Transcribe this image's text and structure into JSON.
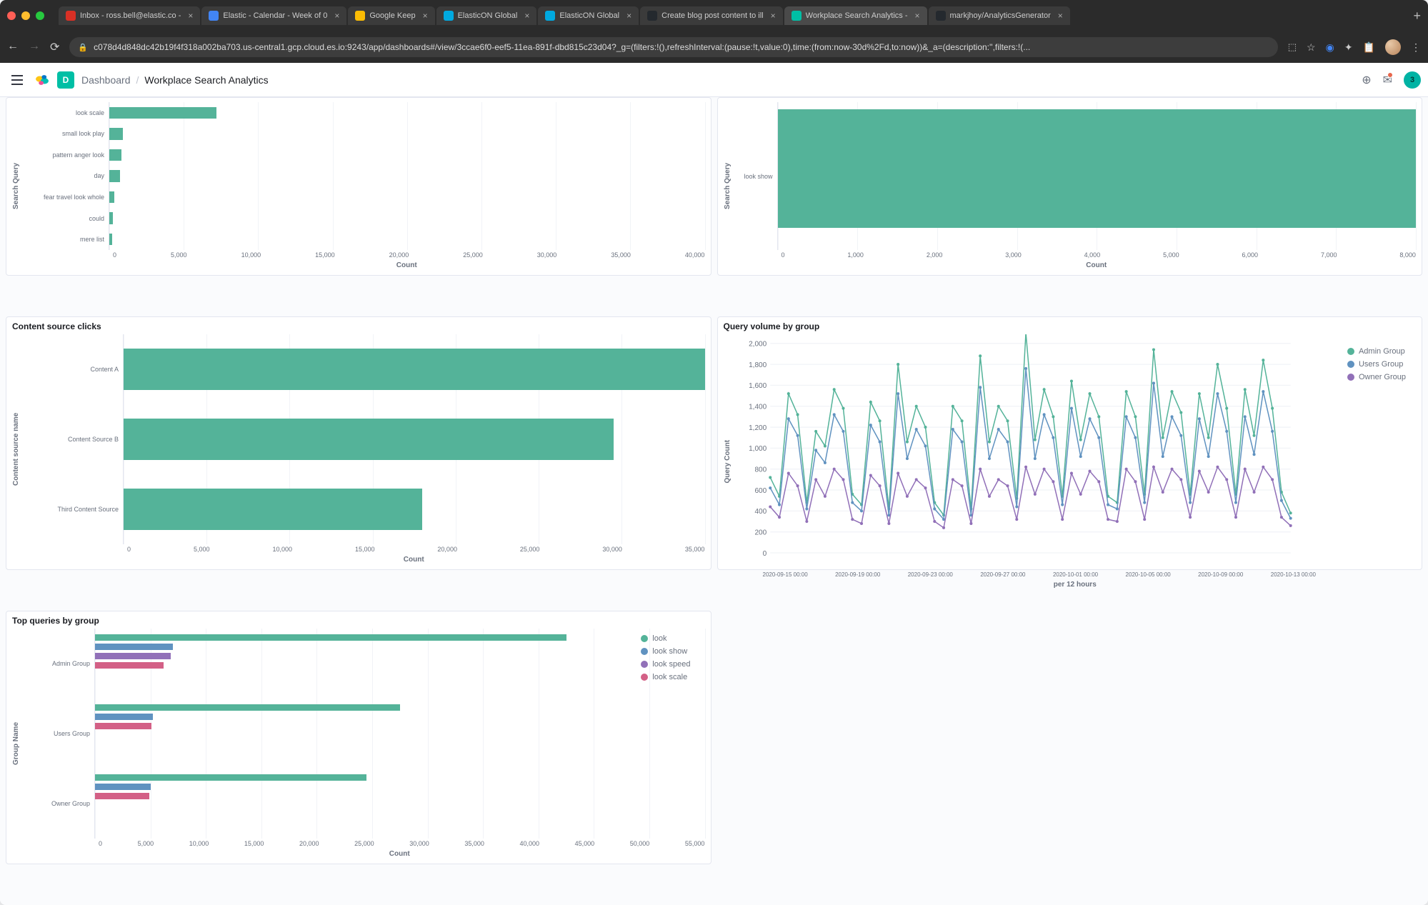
{
  "browser": {
    "tabs": [
      {
        "label": "Inbox - ross.bell@elastic.co -",
        "favicon": "#d93025"
      },
      {
        "label": "Elastic - Calendar - Week of 0",
        "favicon": "#4285f4"
      },
      {
        "label": "Google Keep",
        "favicon": "#fbbc04"
      },
      {
        "label": "ElasticON Global",
        "favicon": "#00a9e0"
      },
      {
        "label": "ElasticON Global",
        "favicon": "#00a9e0"
      },
      {
        "label": "Create blog post content to ill",
        "favicon": "#24292e"
      },
      {
        "label": "Workplace Search Analytics -",
        "favicon": "#00bfa5",
        "active": true
      },
      {
        "label": "markjhoy/AnalyticsGenerator",
        "favicon": "#24292e"
      }
    ],
    "url": "c078d4d848dc42b19f4f318a002ba703.us-central1.gcp.cloud.es.io:9243/app/dashboards#/view/3ccae6f0-eef5-11ea-891f-dbd815c23d04?_g=(filters:!(),refreshInterval:(pause:!t,value:0),time:(from:now-30d%2Fd,to:now))&_a=(description:'',filters:!(..."
  },
  "header": {
    "space_letter": "D",
    "breadcrumb1": "Dashboard",
    "breadcrumb2": "Workplace Search Analytics",
    "badge_count": "3"
  },
  "chart_data": [
    {
      "id": "panel1",
      "type": "bar",
      "orientation": "horizontal",
      "ylabel": "Search Query",
      "xlabel": "Count",
      "xlim": [
        0,
        40000
      ],
      "xticks": [
        "0",
        "5,000",
        "10,000",
        "15,000",
        "20,000",
        "25,000",
        "30,000",
        "35,000",
        "40,000"
      ],
      "categories": [
        "look scale",
        "small look play",
        "pattern anger look",
        "day",
        "fear travel look whole",
        "could",
        "mere list"
      ],
      "values": [
        7200,
        900,
        800,
        700,
        350,
        250,
        200
      ],
      "color": "#54b399"
    },
    {
      "id": "panel2",
      "type": "bar",
      "orientation": "horizontal",
      "ylabel": "Search Query",
      "xlabel": "Count",
      "xlim": [
        0,
        8000
      ],
      "xticks": [
        "0",
        "1,000",
        "2,000",
        "3,000",
        "4,000",
        "5,000",
        "6,000",
        "7,000",
        "8,000"
      ],
      "categories": [
        "look show"
      ],
      "values": [
        8000
      ],
      "color": "#54b399"
    },
    {
      "id": "panel3",
      "title": "Content source clicks",
      "type": "bar",
      "orientation": "horizontal",
      "ylabel": "Content source name",
      "xlabel": "Count",
      "xlim": [
        0,
        35000
      ],
      "xticks": [
        "0",
        "5,000",
        "10,000",
        "15,000",
        "20,000",
        "25,000",
        "30,000",
        "35,000"
      ],
      "categories": [
        "Content A",
        "Content Source B",
        "Third Content Source"
      ],
      "values": [
        35000,
        29500,
        18000
      ],
      "color": "#54b399"
    },
    {
      "id": "panel4",
      "title": "Query volume by group",
      "type": "line",
      "ylabel": "Query Count",
      "xlabel": "per 12 hours",
      "ylim": [
        0,
        2000
      ],
      "yticks": [
        "0",
        "200",
        "400",
        "600",
        "800",
        "1,000",
        "1,200",
        "1,400",
        "1,600",
        "1,800",
        "2,000"
      ],
      "xticks": [
        "2020-09-15 00:00",
        "2020-09-19 00:00",
        "2020-09-23 00:00",
        "2020-09-27 00:00",
        "2020-10-01 00:00",
        "2020-10-05 00:00",
        "2020-10-09 00:00",
        "2020-10-13 00:00"
      ],
      "series": [
        {
          "name": "Admin Group",
          "color": "#54b399",
          "values": [
            720,
            540,
            1520,
            1320,
            480,
            1160,
            1020,
            1560,
            1380,
            560,
            460,
            1440,
            1260,
            420,
            1800,
            1060,
            1400,
            1200,
            480,
            360,
            1400,
            1260,
            420,
            1880,
            1060,
            1400,
            1260,
            520,
            2100,
            1080,
            1560,
            1300,
            540,
            1640,
            1080,
            1520,
            1300,
            540,
            480,
            1540,
            1300,
            560,
            1940,
            1100,
            1540,
            1340,
            560,
            1520,
            1100,
            1800,
            1380,
            560,
            1560,
            1120,
            1840,
            1380,
            580,
            380
          ]
        },
        {
          "name": "Users Group",
          "color": "#6092c0",
          "values": [
            620,
            460,
            1280,
            1120,
            420,
            980,
            860,
            1320,
            1160,
            480,
            400,
            1220,
            1060,
            360,
            1520,
            900,
            1180,
            1020,
            420,
            320,
            1180,
            1060,
            360,
            1580,
            900,
            1180,
            1060,
            440,
            1760,
            900,
            1320,
            1100,
            460,
            1380,
            920,
            1280,
            1100,
            460,
            420,
            1300,
            1100,
            480,
            1620,
            920,
            1300,
            1120,
            480,
            1280,
            920,
            1520,
            1160,
            480,
            1300,
            940,
            1540,
            1160,
            500,
            330
          ]
        },
        {
          "name": "Owner Group",
          "color": "#9170b8",
          "values": [
            440,
            340,
            760,
            640,
            300,
            700,
            540,
            800,
            700,
            320,
            280,
            740,
            640,
            280,
            760,
            540,
            700,
            620,
            300,
            240,
            700,
            640,
            280,
            800,
            540,
            700,
            640,
            320,
            820,
            560,
            800,
            680,
            320,
            760,
            560,
            780,
            680,
            320,
            300,
            800,
            680,
            320,
            820,
            580,
            800,
            700,
            340,
            780,
            580,
            820,
            700,
            340,
            800,
            580,
            820,
            700,
            340,
            260
          ]
        }
      ]
    },
    {
      "id": "panel5",
      "title": "Top queries by group",
      "type": "bar",
      "orientation": "horizontal-grouped",
      "ylabel": "Group Name",
      "xlabel": "Count",
      "xlim": [
        0,
        55000
      ],
      "xticks": [
        "0",
        "5,000",
        "10,000",
        "15,000",
        "20,000",
        "25,000",
        "30,000",
        "35,000",
        "40,000",
        "45,000",
        "50,000",
        "55,000"
      ],
      "groups": [
        "Admin Group",
        "Users Group",
        "Owner Group"
      ],
      "series": [
        {
          "name": "look",
          "color": "#54b399",
          "values": [
            42500,
            27500,
            24500
          ]
        },
        {
          "name": "look show",
          "color": "#6092c0",
          "values": [
            7000,
            5200,
            5000
          ]
        },
        {
          "name": "look speed",
          "color": "#9170b8",
          "values": [
            6800,
            0,
            0
          ]
        },
        {
          "name": "look scale",
          "color": "#d36086",
          "values": [
            6200,
            5100,
            4900
          ]
        }
      ]
    }
  ]
}
